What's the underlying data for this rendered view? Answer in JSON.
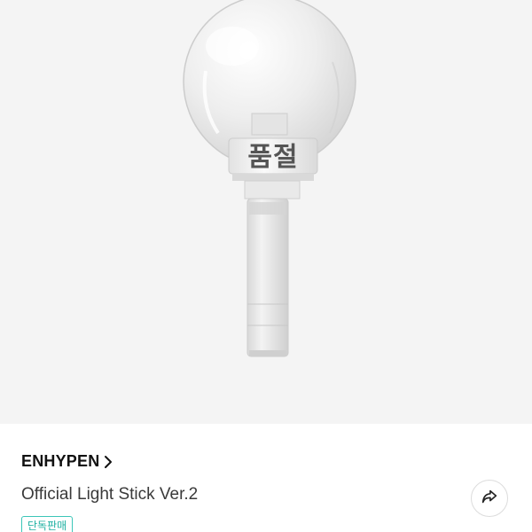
{
  "product": {
    "soldout_label": "품절",
    "brand": "ENHYPEN",
    "name": "Official Light Stick Ver.2",
    "badge": "단독판매"
  },
  "icons": {
    "brand_chevron": "chevron-right-icon",
    "share": "share-arrow-icon"
  },
  "colors": {
    "hero_background": "#f4f4f4",
    "badge_accent": "#1fb0a2",
    "text_primary": "#111111"
  }
}
